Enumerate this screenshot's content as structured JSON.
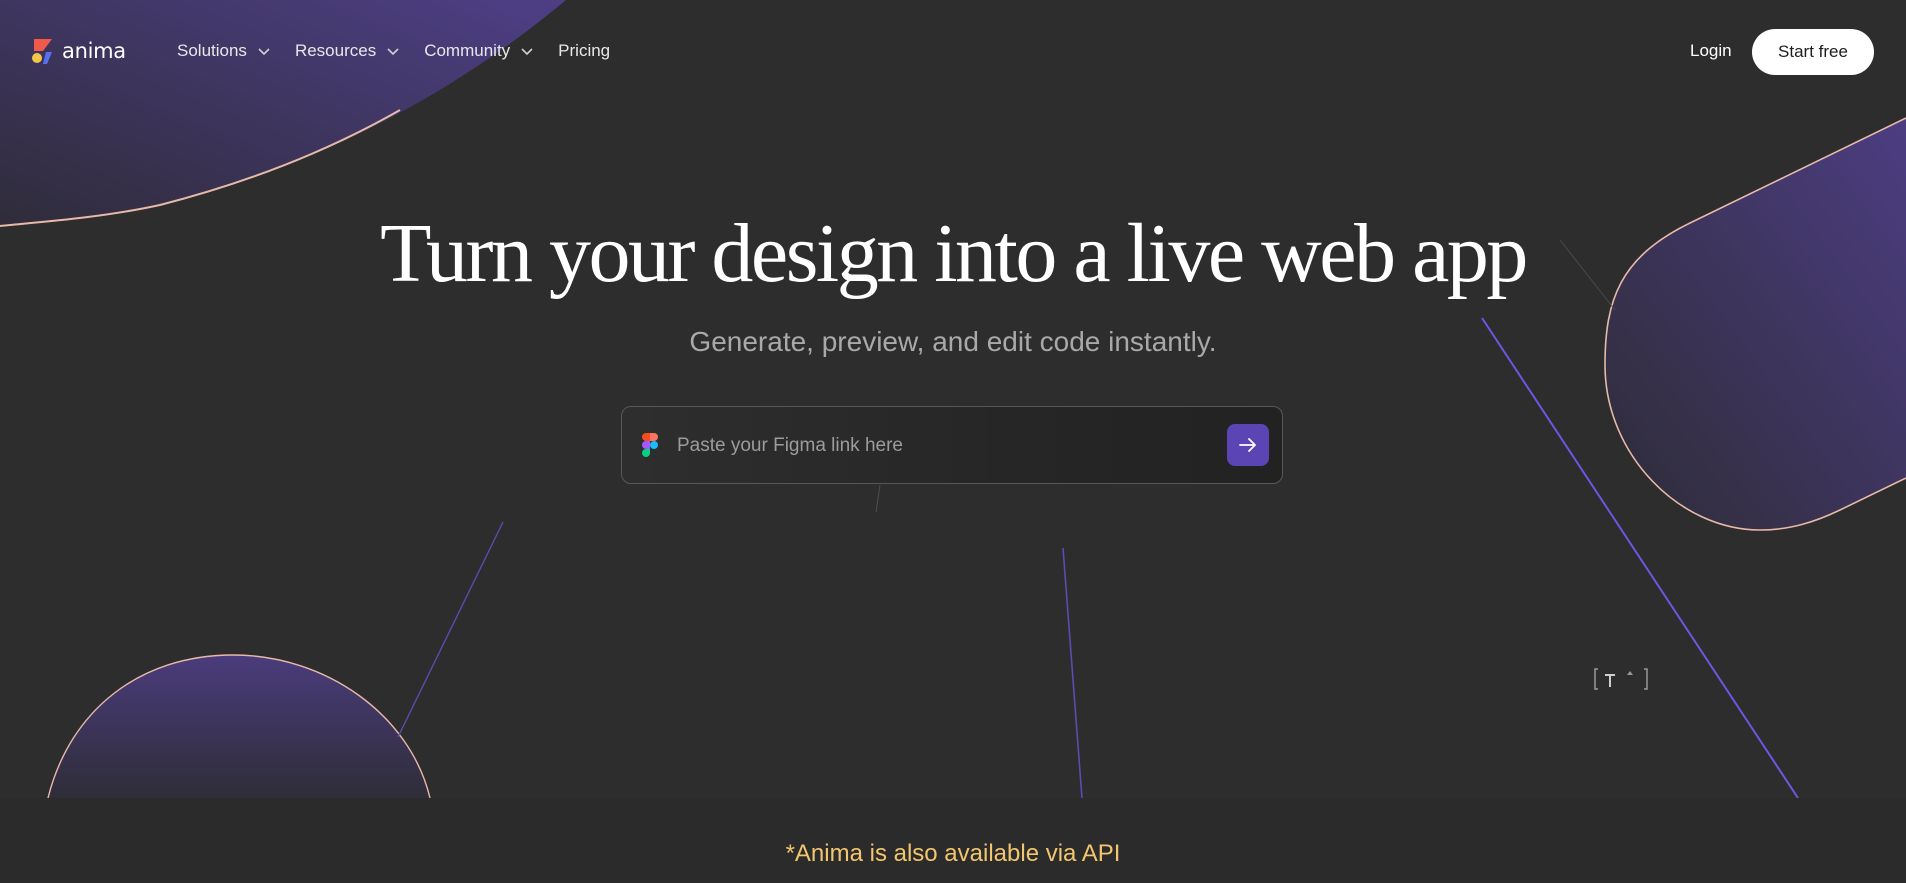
{
  "brand": {
    "name": "anima"
  },
  "nav": {
    "items": [
      {
        "label": "Solutions",
        "icon": "chevron-down-icon"
      },
      {
        "label": "Resources",
        "icon": "chevron-down-icon"
      },
      {
        "label": "Community",
        "icon": "chevron-down-icon"
      },
      {
        "label": "Pricing"
      }
    ],
    "login_label": "Login",
    "start_label": "Start free"
  },
  "hero": {
    "title": "Turn your design into a live web app",
    "subtitle": "Generate, preview, and edit code instantly.",
    "input": {
      "placeholder": "Paste your Figma link here",
      "value": "",
      "icon": "figma-icon",
      "submit_icon": "arrow-right-icon"
    }
  },
  "footer": {
    "api_note": "*Anima is also available via API"
  },
  "colors": {
    "background": "#2c2c2c",
    "accent": "#5b45b5",
    "highlight": "#f2c66e",
    "button_bg": "#ffffff"
  }
}
